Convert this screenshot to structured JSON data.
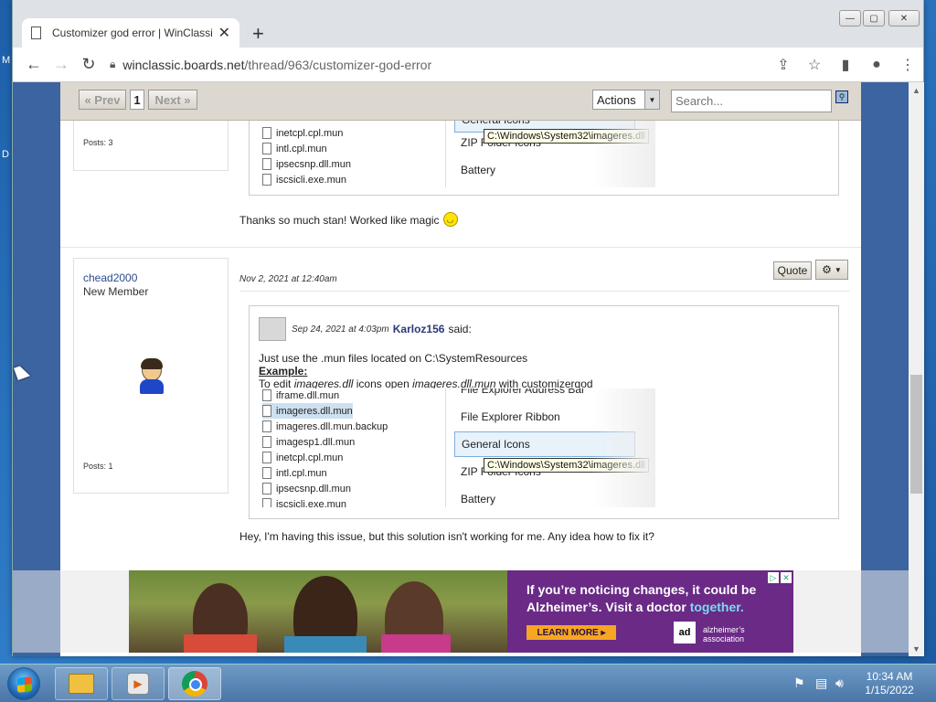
{
  "desktop": {
    "left_letters": [
      "M",
      "D"
    ]
  },
  "browser": {
    "tab_title": "Customizer god error | WinClassic",
    "tab_close": "✕",
    "newtab": "+",
    "url_host": "winclassic.boards.net",
    "url_path": "/thread/963/customizer-god-error",
    "window_controls": [
      "—",
      "▢",
      "✕"
    ]
  },
  "forumbar": {
    "prev": "« Prev",
    "page": "1",
    "next": "Next »",
    "actions": "Actions",
    "search_placeholder": "Search..."
  },
  "post1": {
    "posts": "Posts: 3",
    "files": [
      "inetcpl.cpl.mun",
      "intl.cpl.mun",
      "ipsecsnp.dll.mun",
      "iscsicli.exe.mun"
    ],
    "options": [
      "General Icons",
      "ZIP Folder Icons",
      "Battery"
    ],
    "tooltip": "C:\\Windows\\System32\\imageres.dll",
    "message": "Thanks so much stan! Worked like magic"
  },
  "post2": {
    "username": "chead2000",
    "rank": "New Member",
    "posts": "Posts: 1",
    "date": "Nov 2, 2021 at 12:40am",
    "quote_btn": "Quote",
    "quote": {
      "date": "Sep 24, 2021 at 4:03pm",
      "author": "Karloz156",
      "said": "said:",
      "line1": "Just use the .mun files located on C:\\SystemResources",
      "example": "Example:",
      "line2_a": "To edit ",
      "line2_b": "imageres.dll",
      "line2_c": " icons open ",
      "line2_d": "imageres.dll.mun",
      "line2_e": " with customizergod"
    },
    "files": [
      "iframe.dll.mun",
      "imageres.dll.mun",
      "imageres.dll.mun.backup",
      "imagesp1.dll.mun",
      "inetcpl.cpl.mun",
      "intl.cpl.mun",
      "ipsecsnp.dll.mun",
      "iscsicli.exe.mun"
    ],
    "options": [
      "File Explorer Address Bar",
      "File Explorer Ribbon",
      "General Icons",
      "ZIP Folder Icons",
      "Battery"
    ],
    "tooltip": "C:\\Windows\\System32\\imageres.dll",
    "message": "Hey, I'm having this issue, but this solution isn't working for me. Any idea how to fix it?"
  },
  "ad": {
    "line1": "If you’re noticing changes, it could be",
    "line2a": "Alzheimer’s. Visit a doctor ",
    "line2b": "together.",
    "cta": "LEARN MORE ▸",
    "logo": "ad",
    "org1": "alzheimer’s",
    "org2": "association"
  },
  "taskbar": {
    "time": "10:34 AM",
    "date": "1/15/2022"
  }
}
